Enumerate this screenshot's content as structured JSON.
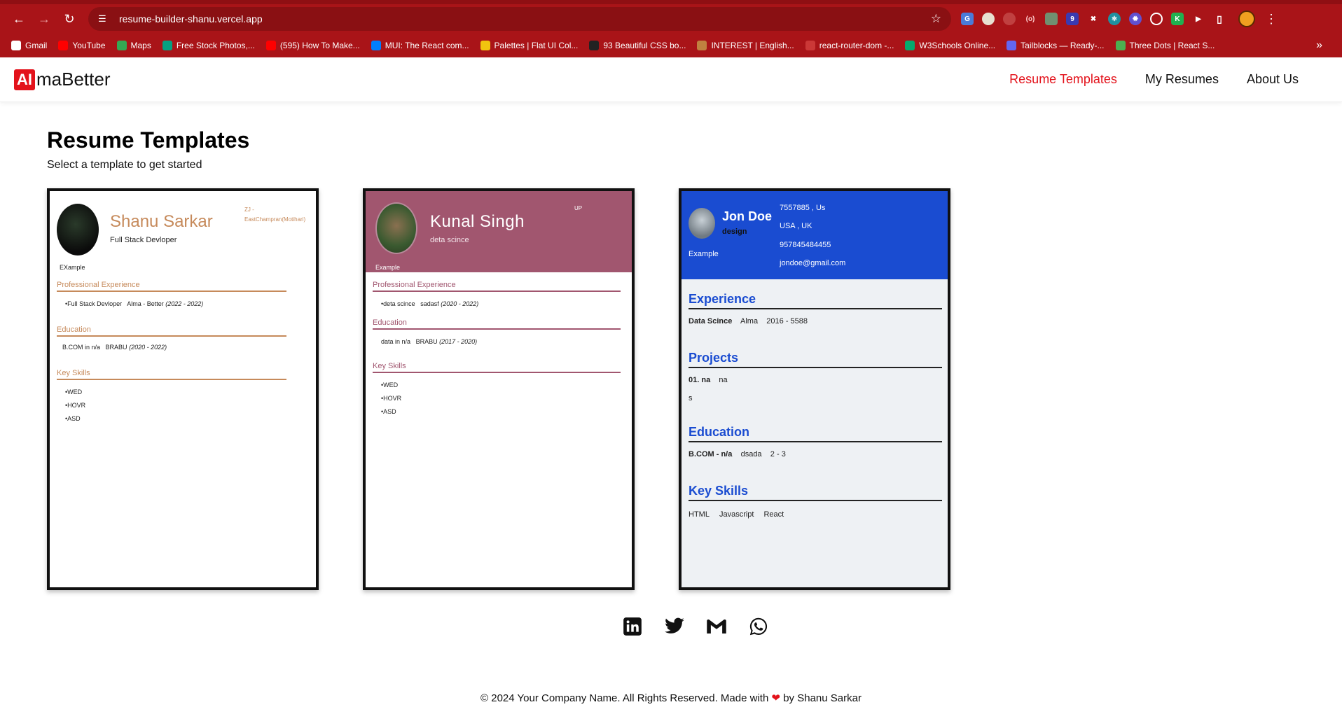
{
  "browser": {
    "url": "resume-builder-shanu.vercel.app",
    "bookmarks": [
      {
        "label": "Gmail",
        "color": "#ffffff"
      },
      {
        "label": "YouTube",
        "color": "#ff0000"
      },
      {
        "label": "Maps",
        "color": "#34a853"
      },
      {
        "label": "Free Stock Photos,...",
        "color": "#05a081"
      },
      {
        "label": "(595) How To Make...",
        "color": "#ff0000"
      },
      {
        "label": "MUI: The React com...",
        "color": "#007fff"
      },
      {
        "label": "Palettes | Flat UI Col...",
        "color": "#f1c40f"
      },
      {
        "label": "93 Beautiful CSS bo...",
        "color": "#222222"
      },
      {
        "label": "INTEREST | English...",
        "color": "#c08040"
      },
      {
        "label": "react-router-dom -...",
        "color": "#cb3837"
      },
      {
        "label": "W3Schools Online...",
        "color": "#04aa6d"
      },
      {
        "label": "Tailblocks — Ready-...",
        "color": "#6366f1"
      },
      {
        "label": "Three Dots | React S...",
        "color": "#4caf50"
      }
    ]
  },
  "header": {
    "logo_ai": "AI",
    "logo_rest": "maBetter",
    "nav": [
      "Resume Templates",
      "My Resumes",
      "About Us"
    ]
  },
  "page": {
    "title": "Resume Templates",
    "subtitle": "Select a template to get started"
  },
  "templates": [
    {
      "name": "Shanu Sarkar",
      "role": "Full Stack Devloper",
      "location": "ZJ - EastChampran(Motihari)",
      "summary": "EXample",
      "sections": {
        "experience": "Professional Experience",
        "education": "Education",
        "skills": "Key Skills"
      },
      "experience_line": {
        "title": "•Full Stack Devloper",
        "org": "Alma - Better",
        "dates": "(2022 - 2022)"
      },
      "education_line": {
        "degree": "B.COM in n/a",
        "org": "BRABU",
        "dates": "(2020 - 2022)"
      },
      "skills": [
        "•WED",
        "•HOVR",
        "•ASD"
      ]
    },
    {
      "name": "Kunal Singh",
      "role": "deta scince",
      "location": "UP",
      "summary": "Example",
      "sections": {
        "experience": "Professional Experience",
        "education": "Education",
        "skills": "Key Skills"
      },
      "experience_line": {
        "title": "•deta scince",
        "org": "sadasf",
        "dates": "(2020 - 2022)"
      },
      "education_line": {
        "degree": "data in n/a",
        "org": "BRABU",
        "dates": "(2017 - 2020)"
      },
      "skills": [
        "•WED",
        "•HOVR",
        "•ASD"
      ]
    },
    {
      "name": "Jon Doe",
      "role": "design",
      "summary": "Example",
      "contacts": [
        "7557885 , Us",
        "USA , UK",
        "957845484455",
        "jondoe@gmail.com"
      ],
      "sections": {
        "experience": "Experience",
        "projects": "Projects",
        "education": "Education",
        "skills": "Key Skills"
      },
      "experience_line": {
        "title": "Data Scince",
        "org": "Alma",
        "dates": "2016 - 5588"
      },
      "project_line": {
        "title": "01. na",
        "desc": "na",
        "extra": "s"
      },
      "education_line": {
        "degree": "B.COM - n/a",
        "org": "dsada",
        "dates": "2 - 3"
      },
      "skills": [
        "HTML",
        "Javascript",
        "React"
      ]
    }
  ],
  "footer": {
    "social_icons": [
      "linkedin-icon",
      "twitter-icon",
      "gmail-icon",
      "whatsapp-icon"
    ],
    "copyright_before": "© 2024 Your Company Name. All Rights Reserved. Made with",
    "heart": "❤",
    "copyright_after": "by Shanu Sarkar"
  },
  "colors": {
    "chrome": "#a91418",
    "accent": "#e3121b",
    "template1_accent": "#c68a5b",
    "template2_accent": "#a1566f",
    "template3_accent": "#1a4cd1"
  }
}
